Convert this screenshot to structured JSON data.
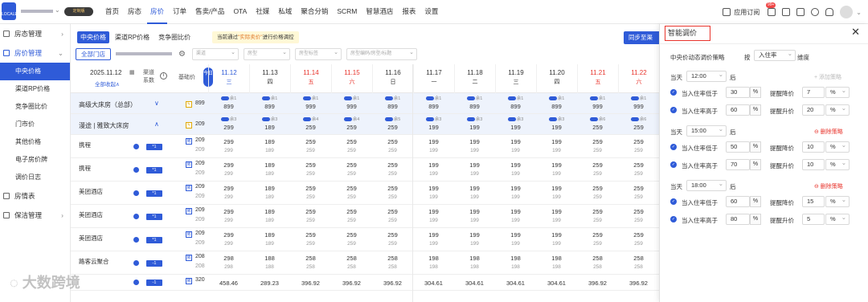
{
  "topbar": {
    "logo_text": "LOCALE",
    "custom_badge": "定制版",
    "nav": [
      "首页",
      "房态",
      "房价",
      "订单",
      "售卖/产品",
      "OTA",
      "社媒",
      "私域",
      "聚合分销",
      "SCRM",
      "智慧酒店",
      "报表",
      "设置"
    ],
    "active_nav": "房价",
    "hot_label": "HOT",
    "app_subscribe": "应用订阅",
    "msg_count": "99+"
  },
  "sidebar": {
    "groups": [
      {
        "label": "房态管理",
        "icon": "house-icon"
      },
      {
        "label": "房价管理",
        "icon": "price-icon",
        "expanded": true,
        "items": [
          "中央价格",
          "渠道RP价格",
          "竞争圈比价",
          "门市价",
          "其他价格",
          "电子房价牌",
          "调价日志"
        ]
      },
      {
        "label": "房情表",
        "icon": "table-icon"
      },
      {
        "label": "保洁管理",
        "icon": "broom-icon"
      }
    ],
    "active_item": "中央价格"
  },
  "main": {
    "tabs": [
      "中央价格",
      "渠道RP价格",
      "竞争圈比价"
    ],
    "notice_prefix": "当前通过",
    "notice_em": "\"实际卖价\"",
    "notice_suffix": "进行价格调控",
    "sync_btn": "同步至渠",
    "filter_all": "全部门店",
    "filter_channel": "渠道",
    "filter_roomtype": "房型",
    "filter_roomtag": "房型标签",
    "filter_search": "房型编码/房型/标题",
    "header": {
      "date": "2025.11.12",
      "collapse_all": "全部收起∧",
      "channel_count": "渠道系数",
      "base_price": "基础价",
      "today": "今日"
    },
    "dates": [
      {
        "d": "11.12",
        "w": "三",
        "c": "blue"
      },
      {
        "d": "11.13",
        "w": "四",
        "c": ""
      },
      {
        "d": "11.14",
        "w": "五",
        "c": "red"
      },
      {
        "d": "11.15",
        "w": "六",
        "c": "red"
      },
      {
        "d": "11.16",
        "w": "日",
        "c": ""
      },
      {
        "d": "11.17",
        "w": "一",
        "c": ""
      },
      {
        "d": "11.18",
        "w": "二",
        "c": ""
      },
      {
        "d": "11.19",
        "w": "三",
        "c": ""
      },
      {
        "d": "11.20",
        "w": "四",
        "c": ""
      },
      {
        "d": "11.21",
        "w": "五",
        "c": "red"
      },
      {
        "d": "11.22",
        "w": "六",
        "c": "red"
      }
    ],
    "rows": [
      {
        "kind": "group",
        "label": "高级大床房（总部）",
        "base": "899",
        "top": [
          "余1",
          "余1",
          "余1",
          "余1",
          "余1",
          "余1",
          "余1",
          "余1",
          "余1",
          "余1",
          "余1"
        ],
        "vals": [
          "899",
          "899",
          "999",
          "999",
          "899",
          "899",
          "899",
          "899",
          "899",
          "999",
          "999"
        ],
        "hl": true
      },
      {
        "kind": "group",
        "label": "漫途 | 雅致大床房",
        "base": "209",
        "top": [
          "余3",
          "余3",
          "余4",
          "余4",
          "余5",
          "余3",
          "余3",
          "余3",
          "余3",
          "余6",
          "余6"
        ],
        "vals": [
          "299",
          "189",
          "259",
          "259",
          "259",
          "199",
          "199",
          "199",
          "199",
          "259",
          "259"
        ],
        "hl": true
      },
      {
        "kind": "ch",
        "label": "携程",
        "coef": "*1",
        "base": "209",
        "sub": "209",
        "vals": [
          "299",
          "189",
          "259",
          "259",
          "259",
          "199",
          "199",
          "199",
          "199",
          "259",
          "259"
        ],
        "subs": [
          "299",
          "189",
          "259",
          "259",
          "259",
          "199",
          "199",
          "199",
          "199",
          "259",
          "259"
        ]
      },
      {
        "kind": "ch",
        "label": "携程",
        "coef": "*1",
        "base": "209",
        "sub": "209",
        "vals": [
          "299",
          "189",
          "259",
          "259",
          "259",
          "199",
          "199",
          "199",
          "199",
          "259",
          "259"
        ],
        "subs": [
          "299",
          "189",
          "259",
          "259",
          "259",
          "199",
          "199",
          "199",
          "199",
          "259",
          "259"
        ]
      },
      {
        "kind": "ch",
        "label": "美团酒店",
        "coef": "*1",
        "base": "209",
        "sub": "209",
        "vals": [
          "299",
          "189",
          "259",
          "259",
          "259",
          "199",
          "199",
          "199",
          "199",
          "259",
          "259"
        ],
        "subs": [
          "299",
          "189",
          "259",
          "259",
          "259",
          "199",
          "199",
          "199",
          "199",
          "259",
          "259"
        ]
      },
      {
        "kind": "ch",
        "label": "美团酒店",
        "coef": "*1",
        "base": "209",
        "sub": "209",
        "vals": [
          "299",
          "189",
          "259",
          "259",
          "259",
          "199",
          "199",
          "199",
          "199",
          "259",
          "259"
        ],
        "subs": [
          "299",
          "189",
          "259",
          "259",
          "259",
          "199",
          "199",
          "199",
          "199",
          "259",
          "259"
        ]
      },
      {
        "kind": "ch",
        "label": "美团酒店",
        "coef": "*1",
        "base": "209",
        "sub": "209",
        "vals": [
          "299",
          "189",
          "259",
          "259",
          "259",
          "199",
          "199",
          "199",
          "199",
          "259",
          "259"
        ],
        "subs": [
          "299",
          "189",
          "259",
          "259",
          "259",
          "199",
          "199",
          "199",
          "199",
          "259",
          "259"
        ]
      },
      {
        "kind": "ch",
        "label": "路客云聚合",
        "coef": "-1",
        "base": "208",
        "sub": "208",
        "vals": [
          "298",
          "188",
          "258",
          "258",
          "258",
          "198",
          "198",
          "198",
          "198",
          "258",
          "258"
        ],
        "subs": [
          "298",
          "188",
          "258",
          "258",
          "258",
          "198",
          "198",
          "198",
          "198",
          "258",
          "258"
        ]
      },
      {
        "kind": "ch",
        "label": "",
        "coef": "-1",
        "base": "320",
        "sub": "",
        "vals": [
          "458.46",
          "289.23",
          "396.92",
          "396.92",
          "396.92",
          "304.61",
          "304.61",
          "304.61",
          "304.61",
          "396.92",
          "396.92"
        ],
        "subs": []
      }
    ]
  },
  "panel": {
    "title": "智能调价",
    "strategy_label": "中央价动态调价策略",
    "by_label": "按",
    "by_value": "入住率",
    "dimension": "维度",
    "day_label": "当天",
    "after_label": "后",
    "add_strategy": "+ 添加策略",
    "delete_strategy": "⊖ 删除策略",
    "low_label": "当入住率低于",
    "high_label": "当入住率高于",
    "down_label": "提醒降价",
    "up_label": "提醒升价",
    "pct": "%",
    "blocks": [
      {
        "time": "12:00",
        "low": "30",
        "down": "7",
        "high": "60",
        "up": "20",
        "first": true
      },
      {
        "time": "15:00",
        "low": "50",
        "down": "10",
        "high": "70",
        "up": "10",
        "first": false
      },
      {
        "time": "18:00",
        "low": "60",
        "down": "15",
        "high": "80",
        "up": "5",
        "first": false
      }
    ]
  },
  "watermark": "大数跨境",
  "colors": {
    "primary": "#2f5bd8",
    "red": "#e8342c"
  }
}
